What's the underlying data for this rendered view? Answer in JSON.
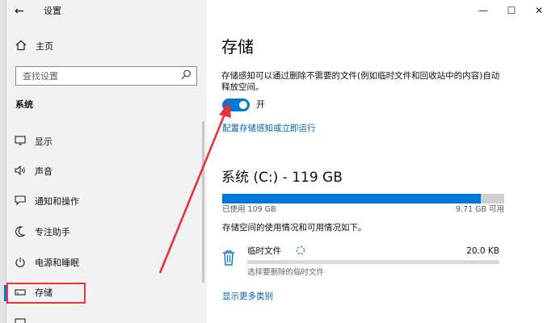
{
  "window": {
    "title": "设置",
    "controls": {
      "minimize": "—",
      "maximize": "☐",
      "close": "✕"
    }
  },
  "sidebar": {
    "back_glyph": "←",
    "home_label": "主页",
    "search_placeholder": "查找设置",
    "section": "系统",
    "items": [
      {
        "label": "显示",
        "icon": "display-icon",
        "glyph": "▭"
      },
      {
        "label": "声音",
        "icon": "sound-icon",
        "glyph": "🔈"
      },
      {
        "label": "通知和操作",
        "icon": "notification-icon",
        "glyph": "▢"
      },
      {
        "label": "专注助手",
        "icon": "moon-icon",
        "glyph": "☾"
      },
      {
        "label": "电源和睡眠",
        "icon": "power-icon",
        "glyph": "⏻"
      },
      {
        "label": "存储",
        "icon": "storage-icon",
        "glyph": "▭"
      }
    ],
    "active_item": "存储"
  },
  "main": {
    "title": "存储",
    "description": "存储感知可以通过删除不需要的文件(例如临时文件和回收站中的内容)自动释放空间。",
    "toggle": {
      "on": true,
      "label": "开"
    },
    "configure_link": "配置存储感知或立即运行",
    "drive": {
      "title": "系统 (C:) - 119 GB",
      "used": "已使用 109 GB",
      "free": "9.71 GB 可用",
      "used_fraction": 0.916
    },
    "usage_description": "存储空间的使用情况和可用情况如下。",
    "category": {
      "name": "临时文件",
      "size": "20.0 KB",
      "subtitle": "选择要删除的临时文件",
      "icon": "trash-icon"
    },
    "more_link": "显示更多类别"
  },
  "colors": {
    "accent": "#0078d7",
    "link": "#0063b1",
    "annotation": "#e8323a",
    "sidebar_bg": "#f2f2f2"
  }
}
